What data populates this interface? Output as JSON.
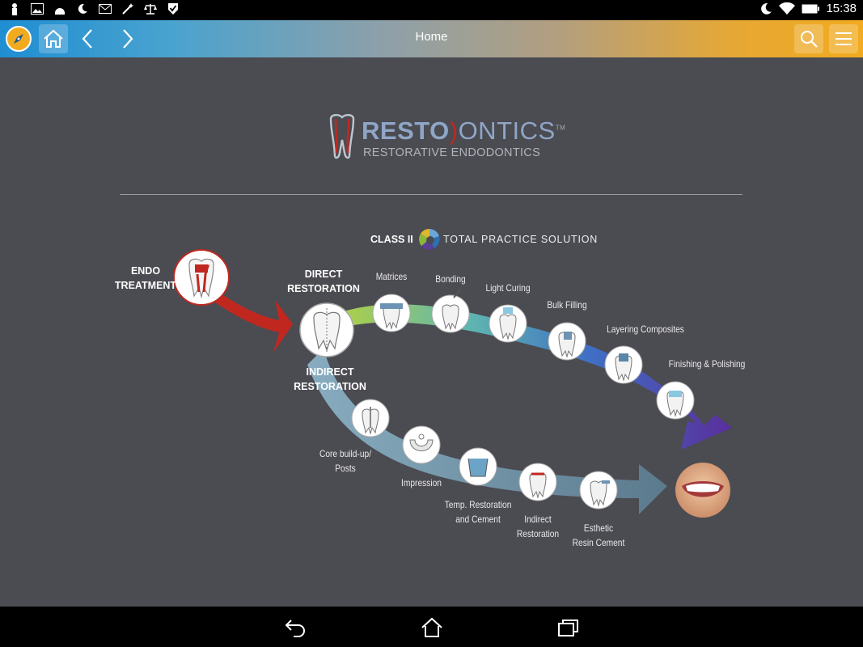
{
  "status_bar": {
    "time": "15:38",
    "left_icons": [
      "notification-icon",
      "image-icon",
      "android-icon",
      "moon-icon",
      "mail-icon",
      "magic-wand-icon",
      "scales-icon",
      "check-shield-icon"
    ],
    "right_icons": [
      "moon-icon",
      "wifi-icon",
      "battery-icon"
    ]
  },
  "toolbar": {
    "title": "Home",
    "accent": "#f2ab1f",
    "primary": "#1f8ed2"
  },
  "brand": {
    "name_part1": "RESTO",
    "name_part2": "ONTICS",
    "trademark": "TM",
    "tagline": "RESTORATIVE ENDODONTICS"
  },
  "solution": {
    "class_label": "CLASS II",
    "name": "TOTAL PRACTICE SOLUTION",
    "trademark": "™"
  },
  "diagram": {
    "start": "ENDO\nTREATMENT",
    "direct": "DIRECT\nRESTORATION",
    "indirect": "INDIRECT\nRESTORATION",
    "direct_steps": [
      "Matrices",
      "Bonding",
      "Light Curing",
      "Bulk Filling",
      "Layering Composites",
      "Finishing & Polishing"
    ],
    "indirect_steps": [
      "Core build-up/\nPosts",
      "Impression",
      "Temp. Restoration\nand Cement",
      "Indirect\nRestoration",
      "Esthetic\nResin Cement"
    ]
  },
  "colors": {
    "background": "#4b4b52",
    "endo_arrow": "#c0281f",
    "direct_arrow_end": "#5a2e9c",
    "indirect_arrow": "#7aa6bd"
  }
}
